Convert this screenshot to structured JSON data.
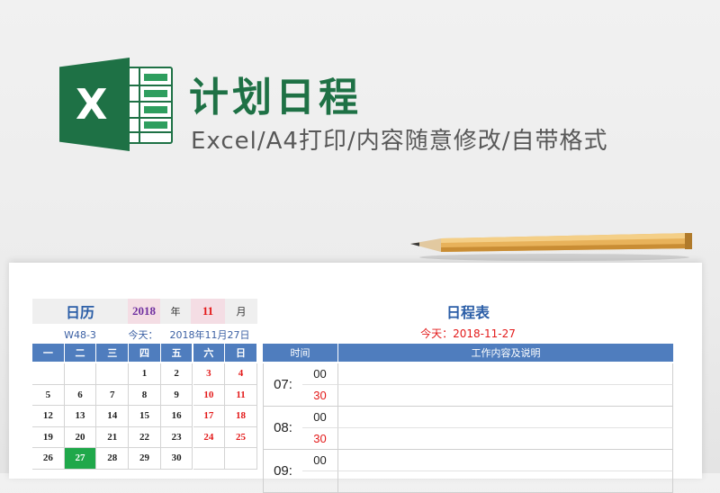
{
  "header": {
    "title": "计划日程",
    "subtitle": "Excel/A4打印/内容随意修改/自带格式"
  },
  "icons": {
    "logo": "excel-logo-icon",
    "logo_letter": "X",
    "pencil": "pencil-icon"
  },
  "colors": {
    "brand_green": "#1e7145",
    "header_blue": "#4f7dbe",
    "today_green": "#1fa84a",
    "accent_red": "#e31a1a",
    "title_blue": "#2b5ea7"
  },
  "calendar": {
    "label": "日历",
    "year": "2018",
    "year_unit": "年",
    "month": "11",
    "month_unit": "月",
    "week_code": "W48-3",
    "today_label": "今天：",
    "today_value": "2018年11月27日",
    "weekdays": [
      "一",
      "二",
      "三",
      "四",
      "五",
      "六",
      "日"
    ],
    "rows": [
      [
        "",
        "",
        "",
        "1",
        "2",
        "3",
        "4"
      ],
      [
        "5",
        "6",
        "7",
        "8",
        "9",
        "10",
        "11"
      ],
      [
        "12",
        "13",
        "14",
        "15",
        "16",
        "17",
        "18"
      ],
      [
        "19",
        "20",
        "21",
        "22",
        "23",
        "24",
        "25"
      ],
      [
        "26",
        "27",
        "28",
        "29",
        "30",
        "",
        ""
      ]
    ],
    "today_day": "27"
  },
  "schedule": {
    "title": "日程表",
    "today_text": "今天：2018-11-27",
    "col_time": "时间",
    "col_content": "工作内容及说明",
    "slots": [
      {
        "hour": "07:",
        "m1": "00",
        "m2": "30"
      },
      {
        "hour": "08:",
        "m1": "00",
        "m2": "30"
      },
      {
        "hour": "09:",
        "m1": "00",
        "m2": ""
      }
    ]
  }
}
